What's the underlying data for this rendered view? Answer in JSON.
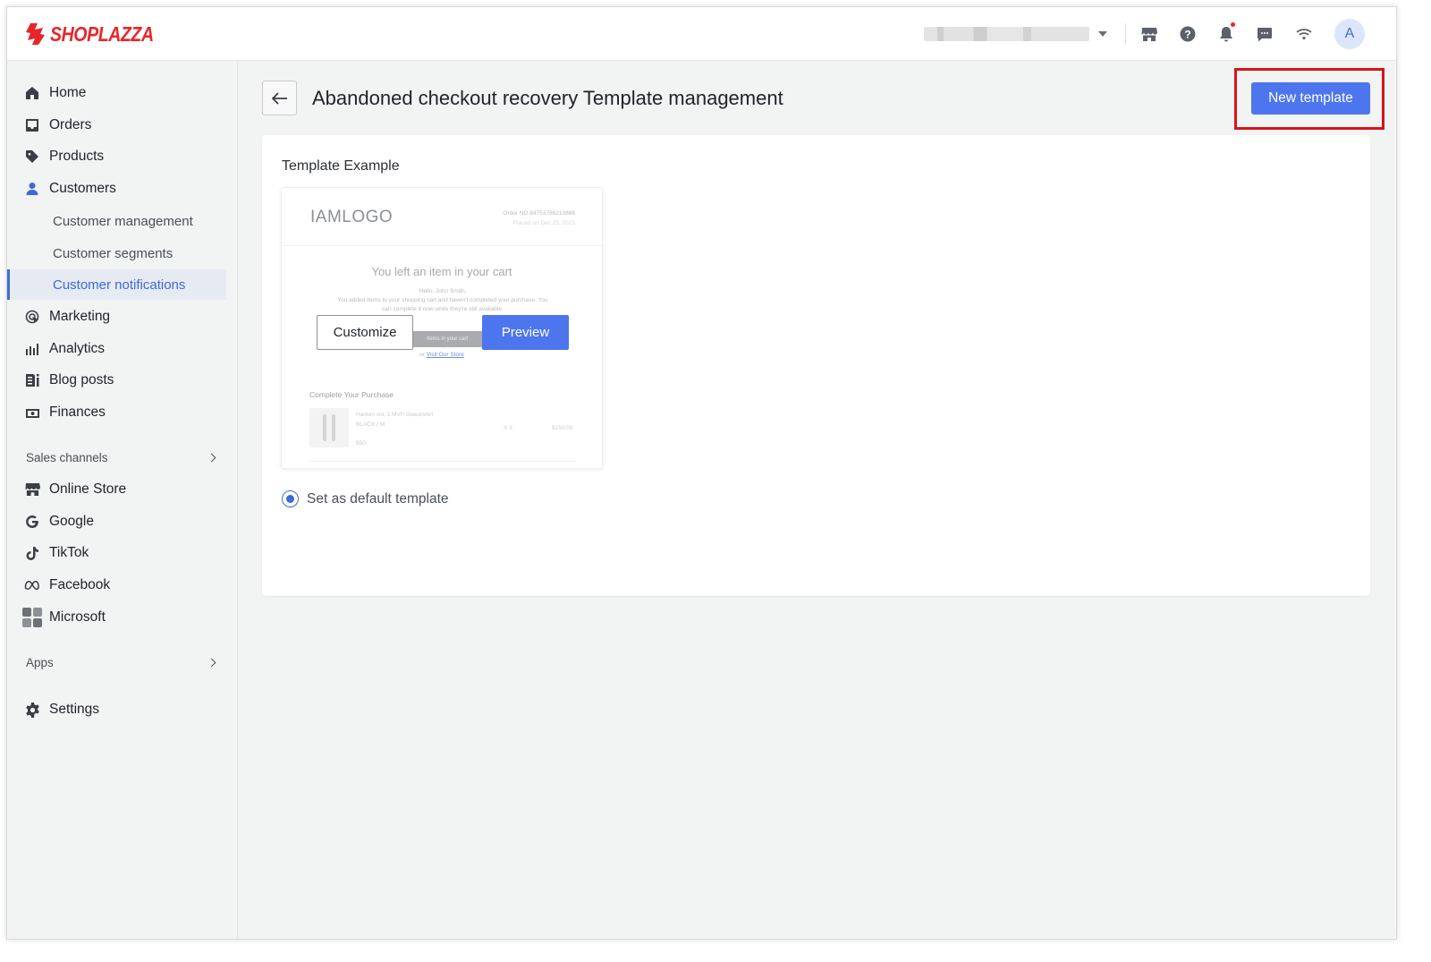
{
  "brand": {
    "name": "SHOPLAZZA",
    "color": "#e8262a"
  },
  "topbar": {
    "store_selector": {
      "value": ""
    },
    "icons": [
      "storefront-icon",
      "help-icon",
      "bell-icon",
      "chat-icon",
      "wifi-icon"
    ],
    "avatar_initial": "A"
  },
  "sidebar": {
    "items": [
      {
        "label": "Home",
        "icon": "home-icon"
      },
      {
        "label": "Orders",
        "icon": "orders-icon"
      },
      {
        "label": "Products",
        "icon": "tag-icon"
      },
      {
        "label": "Customers",
        "icon": "person-icon"
      }
    ],
    "customer_sub": [
      {
        "label": "Customer management"
      },
      {
        "label": "Customer segments"
      },
      {
        "label": "Customer notifications",
        "active": true
      }
    ],
    "items2": [
      {
        "label": "Marketing",
        "icon": "marketing-icon"
      },
      {
        "label": "Analytics",
        "icon": "analytics-icon"
      },
      {
        "label": "Blog posts",
        "icon": "blog-icon"
      },
      {
        "label": "Finances",
        "icon": "finances-icon"
      }
    ],
    "sales_channels_title": "Sales channels",
    "channels": [
      {
        "label": "Online Store",
        "icon": "storefront-icon"
      },
      {
        "label": "Google",
        "icon": "google-icon"
      },
      {
        "label": "TikTok",
        "icon": "tiktok-icon"
      },
      {
        "label": "Facebook",
        "icon": "meta-icon"
      },
      {
        "label": "Microsoft",
        "icon": "microsoft-icon"
      }
    ],
    "apps_title": "Apps",
    "settings_label": "Settings"
  },
  "page": {
    "title": "Abandoned checkout recovery Template management",
    "new_template_label": "New template",
    "accent": "#4d76ee"
  },
  "card": {
    "title": "Template Example",
    "preview": {
      "logo": "IAMLOGO",
      "order_no": "Order NO.84753786210888",
      "placed_on": "Placed on Dec 25, 2023",
      "headline": "You left an item in your cart",
      "greeting": "Hello, John Smith,",
      "body": "You added items to your shopping cart and haven't completed your purchase. You can complete it now while they're still available.",
      "cart_button": "Items in your cart",
      "or_text": "or",
      "visit_link": "Visit Our Store",
      "complete_title": "Complete Your Purchase",
      "product_name": "Hanten vol. 1 MVP Sweatshirt",
      "product_variant": "BLACK / M",
      "product_unit_price": "$50",
      "product_qty": "X 3",
      "product_total": "$150.00"
    },
    "customize_label": "Customize",
    "preview_label": "Preview",
    "default_label": "Set as default template"
  }
}
